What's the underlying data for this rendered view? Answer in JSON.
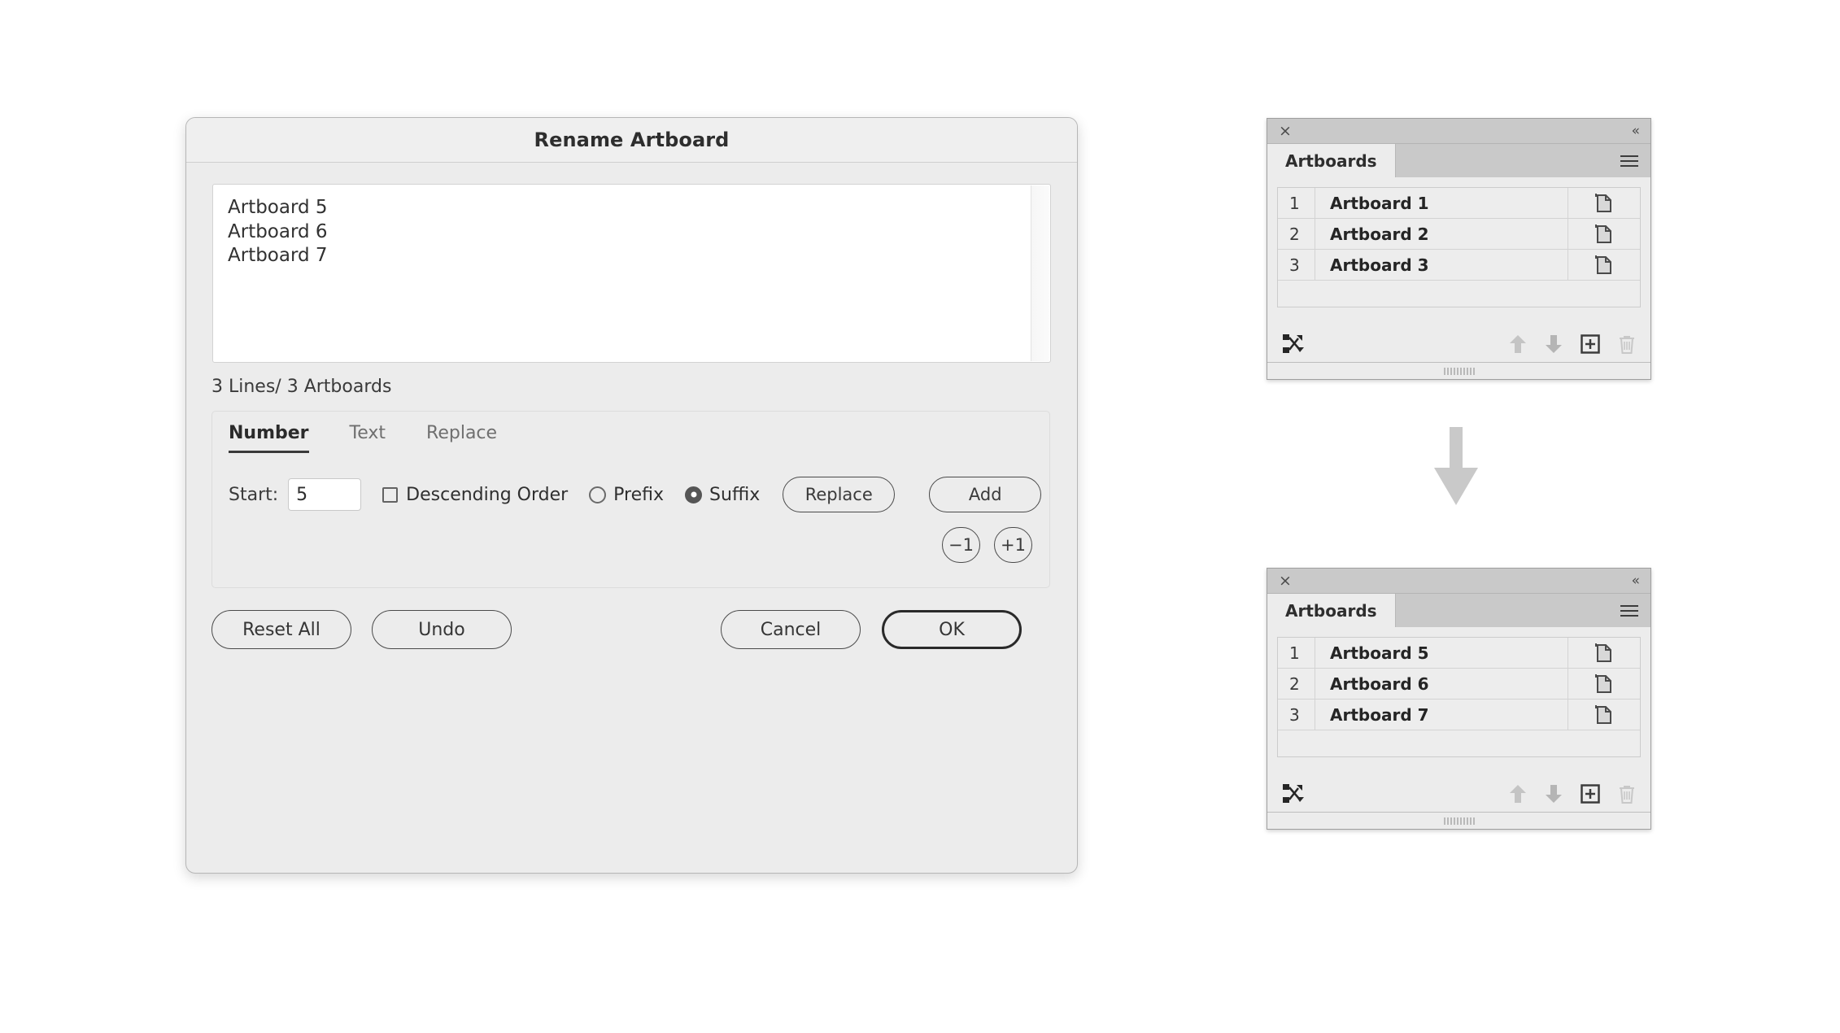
{
  "dialog": {
    "title": "Rename Artboard",
    "names_text": "Artboard 5\nArtboard 6\nArtboard 7",
    "line_count": "3 Lines/ 3 Artboards",
    "tabs": [
      {
        "label": "Number",
        "active": true
      },
      {
        "label": "Text",
        "active": false
      },
      {
        "label": "Replace",
        "active": false
      }
    ],
    "number_tab": {
      "start_label": "Start:",
      "start_value": "5",
      "start_placeholder": "",
      "descending_label": "Descending Order",
      "descending_checked": false,
      "prefix_label": "Prefix",
      "prefix_selected": false,
      "suffix_label": "Suffix",
      "suffix_selected": true,
      "replace_label": "Replace",
      "add_label": "Add",
      "decrement_label": "−1",
      "increment_label": "+1"
    },
    "buttons": {
      "reset_all": "Reset All",
      "undo": "Undo",
      "cancel": "Cancel",
      "ok": "OK"
    }
  },
  "panels": [
    {
      "tab_label": "Artboards",
      "close_icon": "×",
      "collapse_icon": "«",
      "rows": [
        {
          "index": "1",
          "name": "Artboard 1"
        },
        {
          "index": "2",
          "name": "Artboard 2"
        },
        {
          "index": "3",
          "name": "Artboard 3"
        }
      ]
    },
    {
      "tab_label": "Artboards",
      "close_icon": "×",
      "collapse_icon": "«",
      "rows": [
        {
          "index": "1",
          "name": "Artboard 5"
        },
        {
          "index": "2",
          "name": "Artboard 6"
        },
        {
          "index": "3",
          "name": "Artboard 7"
        }
      ]
    }
  ],
  "colors": {
    "dialog_bg": "#ececec",
    "panel_titlebar": "#c9c9c9",
    "accent_border": "#2a2a2a",
    "flow_arrow": "#c9c9c9"
  }
}
